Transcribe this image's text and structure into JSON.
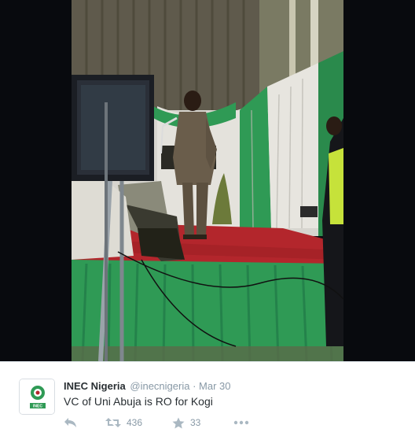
{
  "tweet": {
    "author_name": "INEC Nigeria",
    "author_handle": "@inecnigeria",
    "separator": "·",
    "timestamp": "Mar 30",
    "text": "VC of Uni Abuja is RO for Kogi",
    "avatar_label": "INEC",
    "retweet_count": "436",
    "favorite_count": "33"
  },
  "media": {
    "description_icon": "photo"
  },
  "icons": {
    "reply": "reply-icon",
    "retweet": "retweet-icon",
    "favorite": "star-icon",
    "more": "more-icon"
  },
  "colors": {
    "meta_gray": "#8899a6",
    "text_dark": "#292f33",
    "stage_green": "#2f9a55",
    "stage_red": "#b3262c"
  }
}
